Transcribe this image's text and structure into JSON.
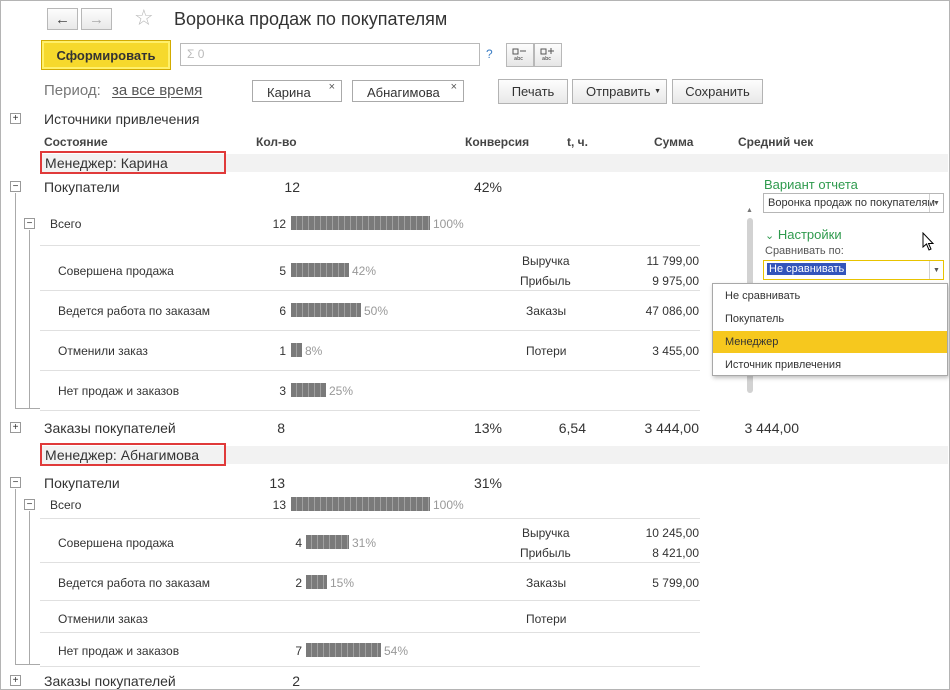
{
  "header": {
    "title": "Воронка продаж по покупателям",
    "back_icon": "←",
    "forward_icon": "→",
    "star_icon": "☆"
  },
  "toolbar": {
    "generate_label": "Сформировать",
    "search_placeholder": "Σ 0",
    "help_label": "?",
    "period_label": "Период:",
    "period_value": "за все время",
    "filter_chips": [
      "Карина",
      "Абнагимова"
    ],
    "chip_close": "×",
    "print_label": "Печать",
    "send_label": "Отправить",
    "save_label": "Сохранить"
  },
  "table": {
    "top_group": "Источники привлечения",
    "columns": [
      "Состояние",
      "Кол-во",
      "Конверсия",
      "t, ч.",
      "Сумма",
      "Средний чек"
    ],
    "groups": [
      {
        "manager": "Менеджер: Карина",
        "customers_label": "Покупатели",
        "customers_count": "12",
        "customers_conversion": "42%",
        "rows": [
          {
            "label": "Всего",
            "count": "12",
            "pct": "100%",
            "fraction": 1.0
          },
          {
            "label": "Совершена продажа",
            "count": "5",
            "pct": "42%",
            "fraction": 0.42,
            "metrics": [
              {
                "name": "Выручка",
                "value": "11 799,00"
              },
              {
                "name": "Прибыль",
                "value": "9 975,00"
              }
            ]
          },
          {
            "label": "Ведется работа по заказам",
            "count": "6",
            "pct": "50%",
            "fraction": 0.5,
            "metrics": [
              {
                "name": "Заказы",
                "value": "47 086,00"
              }
            ]
          },
          {
            "label": "Отменили заказ",
            "count": "1",
            "pct": "8%",
            "fraction": 0.08,
            "metrics": [
              {
                "name": "Потери",
                "value": "3 455,00"
              }
            ]
          },
          {
            "label": "Нет продаж и заказов",
            "count": "3",
            "pct": "25%",
            "fraction": 0.25
          }
        ],
        "orders_label": "Заказы покупателей",
        "orders_count": "8",
        "orders_conversion": "13%",
        "orders_t": "6,54",
        "orders_sum": "3 444,00",
        "orders_avg": "3 444,00"
      },
      {
        "manager": "Менеджер: Абнагимова",
        "customers_label": "Покупатели",
        "customers_count": "13",
        "customers_conversion": "31%",
        "rows": [
          {
            "label": "Всего",
            "count": "13",
            "pct": "100%",
            "fraction": 1.0
          },
          {
            "label": "Совершена продажа",
            "count": "4",
            "pct": "31%",
            "fraction": 0.31,
            "metrics": [
              {
                "name": "Выручка",
                "value": "10 245,00"
              },
              {
                "name": "Прибыль",
                "value": "8 421,00"
              }
            ]
          },
          {
            "label": "Ведется работа по заказам",
            "count": "2",
            "pct": "15%",
            "fraction": 0.15,
            "metrics": [
              {
                "name": "Заказы",
                "value": "5 799,00"
              }
            ]
          },
          {
            "label": "Отменили заказ",
            "count": "",
            "pct": "",
            "fraction": 0,
            "metrics": [
              {
                "name": "Потери",
                "value": ""
              }
            ]
          },
          {
            "label": "Нет продаж и заказов",
            "count": "7",
            "pct": "54%",
            "fraction": 0.54
          }
        ],
        "orders_label": "Заказы покупателей",
        "orders_count": "2"
      }
    ]
  },
  "panel": {
    "variant_title": "Вариант отчета",
    "variant_value": "Воронка продаж по покупателям",
    "settings_title": "Настройки",
    "compare_label": "Сравнивать по:",
    "compare_value": "Не сравнивать",
    "dropdown_options": [
      "Не сравнивать",
      "Покупатель",
      "Менеджер",
      "Источник привлечения"
    ],
    "dropdown_active": "Менеджер"
  }
}
